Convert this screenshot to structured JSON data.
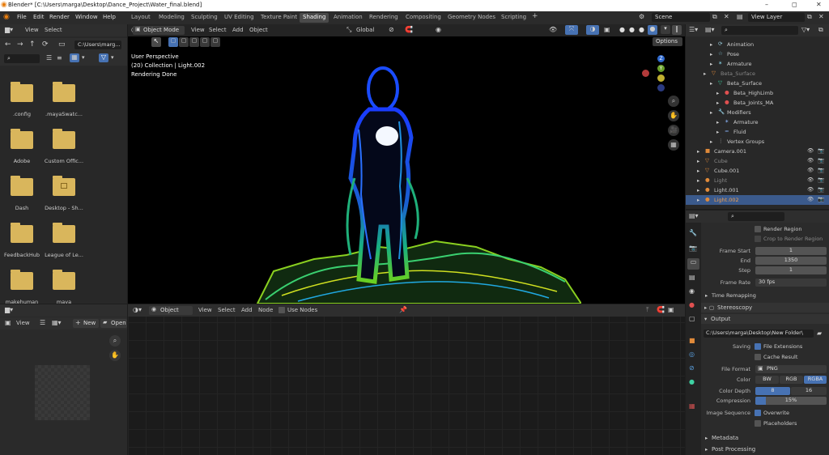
{
  "window": {
    "title": "Blender* [C:\\Users\\marga\\Desktop\\Dance_Project\\Water_final.blend]",
    "minimize": "–",
    "maximize": "◻",
    "close": "✕"
  },
  "menu": [
    "File",
    "Edit",
    "Render",
    "Window",
    "Help"
  ],
  "workspaces": [
    "Layout",
    "Modeling",
    "Sculpting",
    "UV Editing",
    "Texture Paint",
    "Shading",
    "Animation",
    "Rendering",
    "Compositing",
    "Geometry Nodes",
    "Scripting"
  ],
  "active_workspace": "Shading",
  "add_workspace": "+",
  "scene": "Scene",
  "view_layer": "View Layer",
  "file_browser": {
    "menu": [
      "View",
      "Select"
    ],
    "path": "C:\\Users\\marg...",
    "folders": [
      ".config",
      ".mayaSwatc...",
      "Adobe",
      "Custom Offic...",
      "Dash",
      "Desktop - Sh...",
      "FeedbackHub",
      "League of Le...",
      "makehuman",
      "maya"
    ]
  },
  "viewport": {
    "mode": "Object Mode",
    "menus": [
      "View",
      "Select",
      "Add",
      "Object"
    ],
    "orientation": "Global",
    "options": "Options",
    "info_lines": [
      "User Perspective",
      "(20) Collection | Light.002",
      "Rendering Done"
    ],
    "gizmo": {
      "z": "Z",
      "y": "Y"
    }
  },
  "node_editor": {
    "type": "Object",
    "menus": [
      "View",
      "Select",
      "Add",
      "Node"
    ],
    "use_nodes": "Use Nodes"
  },
  "image_editor": {
    "view": "View",
    "new": "New",
    "open": "Open"
  },
  "outliner": {
    "rows": [
      {
        "label": "Animation",
        "indent": 5,
        "icon": "⟳",
        "icon_color": "#9cd0e0",
        "text_color": "#ccc",
        "selected": false
      },
      {
        "label": "Pose",
        "indent": 5,
        "icon": "☆",
        "icon_color": "#7fc3d4",
        "text_color": "#ccc",
        "selected": false
      },
      {
        "label": "Armature",
        "indent": 5,
        "icon": "✶",
        "icon_color": "#7fc3d4",
        "text_color": "#ccc",
        "selected": false
      },
      {
        "label": "Beta_Surface",
        "indent": 4,
        "icon": "▽",
        "icon_color": "#e08a3a",
        "text_color": "#888",
        "selected": false
      },
      {
        "label": "Beta_Surface",
        "indent": 5,
        "icon": "▽",
        "icon_color": "#3ed1a2",
        "text_color": "#ccc",
        "selected": false
      },
      {
        "label": "Beta_HighLimb",
        "indent": 6,
        "icon": "●",
        "icon_color": "#e05050",
        "text_color": "#ccc",
        "selected": false
      },
      {
        "label": "Beta_Joints_MA",
        "indent": 6,
        "icon": "●",
        "icon_color": "#e05050",
        "text_color": "#ccc",
        "selected": false
      },
      {
        "label": "Modifiers",
        "indent": 5,
        "icon": "🔧",
        "icon_color": "#7fa3e0",
        "text_color": "#ccc",
        "selected": false
      },
      {
        "label": "Armature",
        "indent": 6,
        "icon": "✶",
        "icon_color": "#7fa3e0",
        "text_color": "#ccc",
        "selected": false
      },
      {
        "label": "Fluid",
        "indent": 6,
        "icon": "≈",
        "icon_color": "#7fa3e0",
        "text_color": "#ccc",
        "selected": false
      },
      {
        "label": "Vertex Groups",
        "indent": 5,
        "icon": "⋮",
        "icon_color": "#aaa",
        "text_color": "#ccc",
        "selected": false
      },
      {
        "label": "Camera.001",
        "indent": 3,
        "icon": "■",
        "icon_color": "#e08a3a",
        "text_color": "#ccc",
        "selected": false
      },
      {
        "label": "Cube",
        "indent": 3,
        "icon": "▽",
        "icon_color": "#e08a3a",
        "text_color": "#888",
        "selected": false
      },
      {
        "label": "Cube.001",
        "indent": 3,
        "icon": "▽",
        "icon_color": "#e08a3a",
        "text_color": "#ccc",
        "selected": false
      },
      {
        "label": "Light",
        "indent": 3,
        "icon": "●",
        "icon_color": "#e08a3a",
        "text_color": "#888",
        "selected": false
      },
      {
        "label": "Light.001",
        "indent": 3,
        "icon": "●",
        "icon_color": "#e08a3a",
        "text_color": "#ccc",
        "selected": false
      },
      {
        "label": "Light.002",
        "indent": 3,
        "icon": "●",
        "icon_color": "#e08a3a",
        "text_color": "#f0a050",
        "selected": true
      }
    ]
  },
  "properties": {
    "render_region": "Render Region",
    "crop_region": "Crop to Render Region",
    "frame_start_label": "Frame Start",
    "frame_start": "1",
    "end_label": "End",
    "end": "1350",
    "step_label": "Step",
    "step": "1",
    "frame_rate_label": "Frame Rate",
    "frame_rate": "30 fps",
    "time_remapping": "Time Remapping",
    "stereoscopy": "Stereoscopy",
    "output": "Output",
    "output_path": "C:\\Users\\marga\\Desktop\\New Folder\\",
    "saving_label": "Saving",
    "file_extensions": "File Extensions",
    "cache_result": "Cache Result",
    "file_format_label": "File Format",
    "file_format": "PNG",
    "color_label": "Color",
    "color_options": [
      "BW",
      "RGB",
      "RGBA"
    ],
    "color_selected": "RGBA",
    "color_depth_label": "Color Depth",
    "color_depth_options": [
      "8",
      "16"
    ],
    "color_depth_selected": "8",
    "compression_label": "Compression",
    "compression": "15%",
    "compression_value": 0.15,
    "image_sequence_label": "Image Sequence",
    "overwrite": "Overwrite",
    "placeholders": "Placeholders",
    "metadata": "Metadata",
    "post_processing": "Post Processing"
  },
  "colors": {
    "accent": "#4772b3",
    "selected_row": "#3b5a8c",
    "folder": "#d9b65c"
  }
}
